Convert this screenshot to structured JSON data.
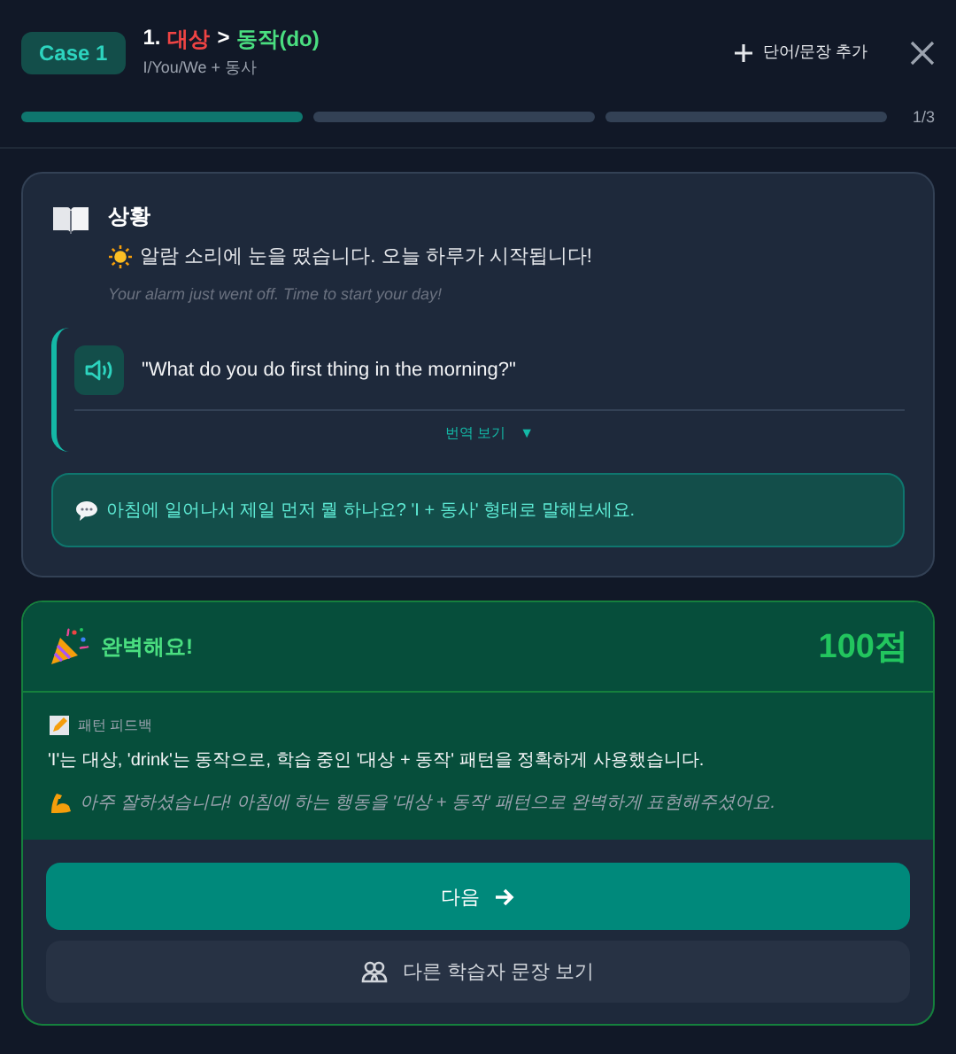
{
  "header": {
    "badge": "Case 1",
    "title_parts": [
      {
        "text": "1.",
        "color": "#ffffff"
      },
      {
        "text": "대상",
        "color": "#ef4444"
      },
      {
        "text": ">",
        "color": "#ffffff"
      },
      {
        "text": "동작(do)",
        "color": "#4ade80"
      }
    ],
    "subtitle": "I/You/We + 동사",
    "add_button": "단어/문장 추가"
  },
  "progress": {
    "segments": [
      {
        "done": true
      },
      {
        "done": false
      },
      {
        "done": false
      }
    ],
    "counter": "1/3"
  },
  "situation": {
    "heading": "상황",
    "text": "알람 소리에 눈을 떴습니다. 오늘 하루가 시작됩니다!",
    "translation": "Your alarm just went off. Time to start your day!",
    "question": "\"What do you do first thing in the morning?\"",
    "translation_toggle": "번역 보기",
    "toggle_arrow": "▼",
    "hint": "아침에 일어나서 제일 먼저 뭘 하나요? 'I + 동사' 형태로 말해보세요."
  },
  "result": {
    "title": "완벽해요!",
    "score": "100점",
    "feedback_label": "패턴 피드백",
    "feedback": "'I'는 대상, 'drink'는 동작으로, 학습 중인 '대상 + 동작' 패턴을 정확하게 사용했습니다.",
    "praise": "아주 잘하셨습니다! 아침에 하는 행동을 '대상 + 동작' 패턴으로 완벽하게 표현해주셨어요."
  },
  "buttons": [
    {
      "kind": "primary",
      "label": "다음"
    },
    {
      "kind": "secondary",
      "label": "다른 학습자 문장 보기"
    }
  ]
}
